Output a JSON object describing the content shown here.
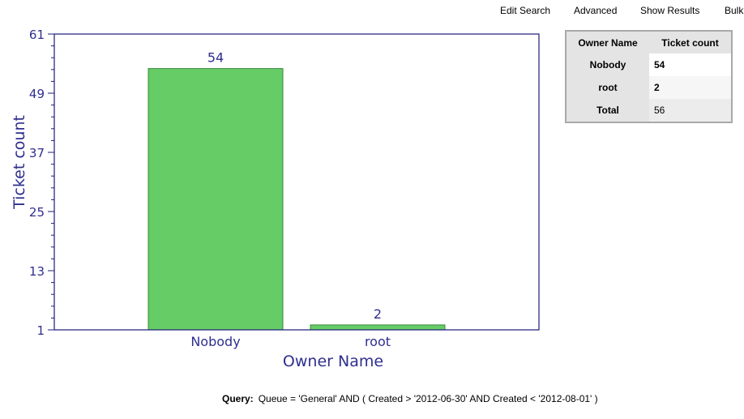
{
  "nav": {
    "items": [
      "Edit Search",
      "Advanced",
      "Show Results",
      "Bulk"
    ]
  },
  "colors": {
    "bar_fill": "#66cc66",
    "bar_stroke": "#3a8a3a",
    "axis": "#1c1c7a",
    "text": "#2f2f8f"
  },
  "chart_data": {
    "type": "bar",
    "title": "",
    "xlabel": "Owner Name",
    "ylabel": "Ticket count",
    "categories": [
      "Nobody",
      "root"
    ],
    "values": [
      54,
      2
    ],
    "data_labels": [
      "54",
      "2"
    ],
    "ylim": [
      1,
      61
    ],
    "yticks": [
      1,
      13,
      25,
      37,
      49,
      61
    ],
    "ytick_labels": [
      "1",
      "13",
      "25",
      "37",
      "49",
      "61"
    ],
    "minor_ticks_per_major": 5,
    "grid": false,
    "legend": "none"
  },
  "summary_table": {
    "headers": [
      "Owner Name",
      "Ticket count"
    ],
    "rows": [
      {
        "name": "Nobody",
        "count": "54"
      },
      {
        "name": "root",
        "count": "2"
      }
    ],
    "total": {
      "label": "Total",
      "count": "56"
    }
  },
  "query": {
    "label": "Query:",
    "text": "Queue = 'General' AND ( Created > '2012-06-30' AND Created < '2012-08-01' )"
  }
}
